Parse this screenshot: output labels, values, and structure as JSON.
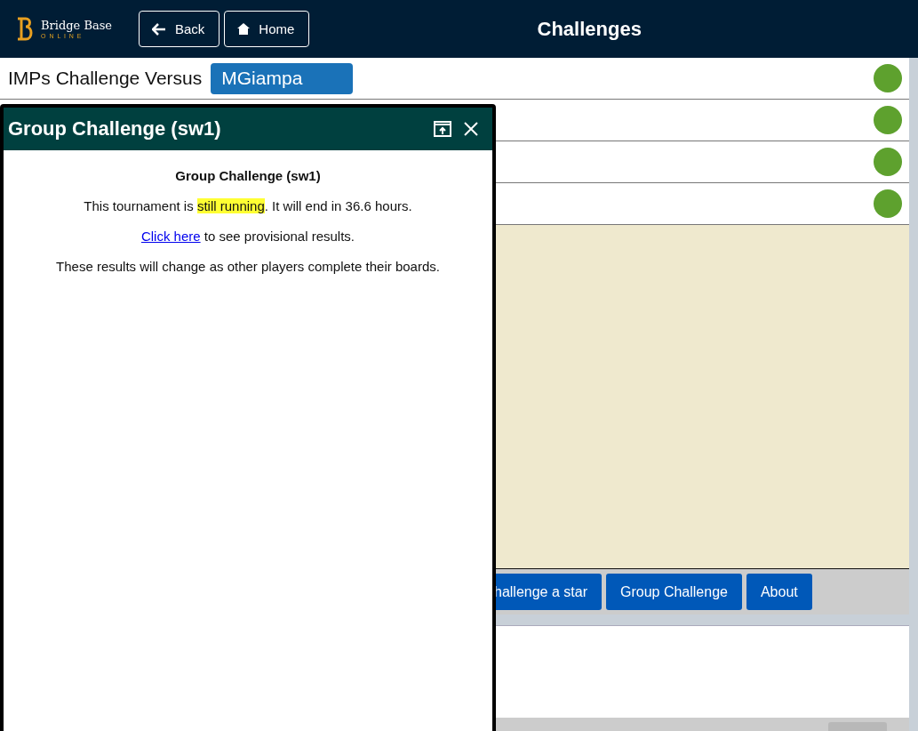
{
  "header": {
    "logo": {
      "name": "Bridge Base",
      "tagline": "O N L I N E"
    },
    "buttons": [
      {
        "label": "Back",
        "kind": "back"
      },
      {
        "label": "Home",
        "kind": "home"
      }
    ],
    "title": "Challenges"
  },
  "rows": [
    {
      "label": "IMPs Challenge Versus",
      "opponent": "MGiampa",
      "color": "#5ea12e"
    },
    {
      "color": "#5ea12e"
    },
    {
      "color": "#5ea12e"
    },
    {
      "color": "#5ea12e"
    }
  ],
  "action_buttons": [
    "hallenge a star",
    "Group Challenge",
    "About"
  ],
  "dialog": {
    "title": "Group Challenge (sw1)",
    "heading": "Group Challenge (sw1)",
    "status_before": "This tournament is ",
    "status_highlight": "still running",
    "status_after": ". It will end in 36.6 hours.",
    "link": "Click here",
    "link_after": " to see provisional results.",
    "note": "These results will change as other players complete their boards."
  }
}
